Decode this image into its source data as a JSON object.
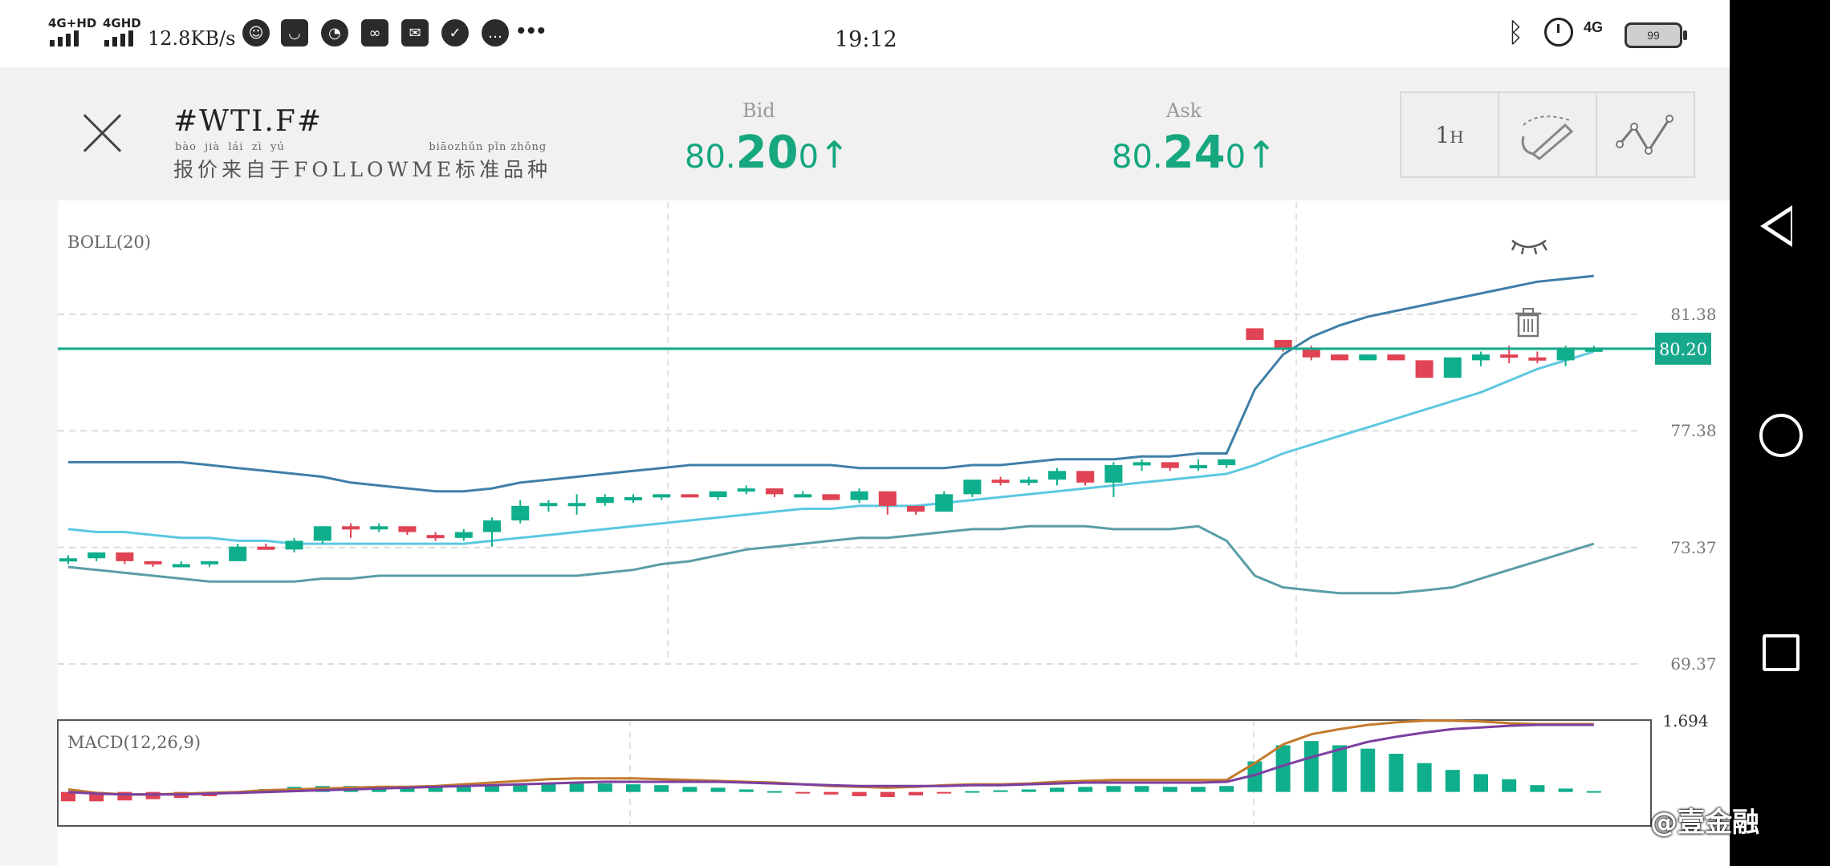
{
  "status_bar": {
    "sim1": "4G+HD",
    "sim2": "4GHD",
    "net_speed": "12.8KB/s",
    "time": "19:12",
    "net_right": "4G",
    "battery": "99"
  },
  "header": {
    "symbol": "#WTI.F#",
    "source_pinyin": "bào  jià  lái  zì  yú                                   biāozhǔn pǐn zhǒng",
    "source": "报价来自于FOLLOWME标准品种",
    "bid": {
      "label": "Bid",
      "prefix": "80.",
      "big": "20",
      "suffix": "0",
      "arrow": "↑"
    },
    "ask": {
      "label": "Ask",
      "prefix": "80.",
      "big": "24",
      "suffix": "0",
      "arrow": "↑"
    },
    "timeframe": {
      "num": "1",
      "unit": "H"
    }
  },
  "icons": [
    "close-icon",
    "draw-tool-icon",
    "indicator-line-icon",
    "eye-closed-icon",
    "trash-icon",
    "back-icon",
    "home-icon",
    "recent-apps-icon"
  ],
  "colors": {
    "bull": "#0fae8c",
    "bear": "#e04353",
    "boll_upper": "#3f7fa8",
    "boll_mid": "#5cc8e0",
    "boll_lower": "#5a9ea6",
    "price_line": "#17a88c",
    "macd_fast": "#c47a2c",
    "macd_slow": "#7b3fa0"
  },
  "watermark": "@壹金融",
  "chart_data": {
    "type": "candlestick",
    "main": {
      "indicator_label": "BOLL(20)",
      "y_ticks": [
        "81.38",
        "77.38",
        "73.37",
        "69.37"
      ],
      "ylim": [
        69.37,
        81.38
      ],
      "current_price": "80.20",
      "candles": [
        [
          72.9,
          73.1,
          72.8,
          73.0
        ],
        [
          73.0,
          73.2,
          72.9,
          73.2
        ],
        [
          73.2,
          73.2,
          72.8,
          72.9
        ],
        [
          72.9,
          72.9,
          72.7,
          72.8
        ],
        [
          72.8,
          72.9,
          72.7,
          72.8
        ],
        [
          72.8,
          72.9,
          72.7,
          72.9
        ],
        [
          72.9,
          73.5,
          72.9,
          73.4
        ],
        [
          73.4,
          73.5,
          73.3,
          73.3
        ],
        [
          73.3,
          73.7,
          73.2,
          73.6
        ],
        [
          73.6,
          74.1,
          73.5,
          74.1
        ],
        [
          74.1,
          74.2,
          73.7,
          74.0
        ],
        [
          74.0,
          74.2,
          73.9,
          74.1
        ],
        [
          74.1,
          74.1,
          73.8,
          73.9
        ],
        [
          73.8,
          73.9,
          73.6,
          73.7
        ],
        [
          73.7,
          74.0,
          73.6,
          73.9
        ],
        [
          73.9,
          74.4,
          73.4,
          74.3
        ],
        [
          74.3,
          75.0,
          74.2,
          74.8
        ],
        [
          74.8,
          75.0,
          74.6,
          74.9
        ],
        [
          74.9,
          75.2,
          74.5,
          74.9
        ],
        [
          74.9,
          75.2,
          74.8,
          75.1
        ],
        [
          75.1,
          75.2,
          74.9,
          75.1
        ],
        [
          75.1,
          75.2,
          75.0,
          75.2
        ],
        [
          75.2,
          75.2,
          75.1,
          75.1
        ],
        [
          75.1,
          75.3,
          75.0,
          75.3
        ],
        [
          75.3,
          75.5,
          75.2,
          75.4
        ],
        [
          75.4,
          75.4,
          75.1,
          75.2
        ],
        [
          75.2,
          75.3,
          75.1,
          75.2
        ],
        [
          75.2,
          75.2,
          75.0,
          75.0
        ],
        [
          75.0,
          75.4,
          74.9,
          75.3
        ],
        [
          75.3,
          75.3,
          74.5,
          74.8
        ],
        [
          74.8,
          74.8,
          74.5,
          74.6
        ],
        [
          74.6,
          75.3,
          74.6,
          75.2
        ],
        [
          75.2,
          75.7,
          75.1,
          75.7
        ],
        [
          75.7,
          75.8,
          75.5,
          75.6
        ],
        [
          75.6,
          75.8,
          75.5,
          75.7
        ],
        [
          75.7,
          76.1,
          75.5,
          76.0
        ],
        [
          76.0,
          76.0,
          75.5,
          75.6
        ],
        [
          75.6,
          76.3,
          75.1,
          76.2
        ],
        [
          76.2,
          76.4,
          76.0,
          76.3
        ],
        [
          76.3,
          76.3,
          76.0,
          76.1
        ],
        [
          76.1,
          76.4,
          76.0,
          76.2
        ],
        [
          76.2,
          76.4,
          76.1,
          76.4
        ],
        [
          80.9,
          80.9,
          80.5,
          80.5
        ],
        [
          80.5,
          80.5,
          80.1,
          80.2
        ],
        [
          80.2,
          80.3,
          79.8,
          79.9
        ],
        [
          80.0,
          80.0,
          79.8,
          79.8
        ],
        [
          79.8,
          80.0,
          79.8,
          80.0
        ],
        [
          80.0,
          80.0,
          79.8,
          79.8
        ],
        [
          79.8,
          79.8,
          79.2,
          79.2
        ],
        [
          79.2,
          79.9,
          79.2,
          79.9
        ],
        [
          79.8,
          80.1,
          79.6,
          80.0
        ],
        [
          80.0,
          80.3,
          79.7,
          79.9
        ],
        [
          79.9,
          80.1,
          79.7,
          79.8
        ],
        [
          79.8,
          80.3,
          79.6,
          80.2
        ],
        [
          80.2,
          80.3,
          80.1,
          80.2
        ]
      ],
      "boll_upper": [
        76.3,
        76.3,
        76.3,
        76.3,
        76.3,
        76.2,
        76.1,
        76.0,
        75.9,
        75.8,
        75.6,
        75.5,
        75.4,
        75.3,
        75.3,
        75.4,
        75.6,
        75.7,
        75.8,
        75.9,
        76.0,
        76.1,
        76.2,
        76.2,
        76.2,
        76.2,
        76.2,
        76.2,
        76.1,
        76.1,
        76.1,
        76.1,
        76.2,
        76.2,
        76.3,
        76.4,
        76.4,
        76.4,
        76.5,
        76.5,
        76.6,
        76.6,
        78.8,
        80.0,
        80.6,
        81.0,
        81.3,
        81.5,
        81.7,
        81.9,
        82.1,
        82.3,
        82.5,
        82.6,
        82.7
      ],
      "boll_mid": [
        74.0,
        73.9,
        73.9,
        73.8,
        73.7,
        73.7,
        73.6,
        73.6,
        73.5,
        73.5,
        73.5,
        73.5,
        73.5,
        73.5,
        73.5,
        73.6,
        73.7,
        73.8,
        73.9,
        74.0,
        74.1,
        74.2,
        74.3,
        74.4,
        74.5,
        74.6,
        74.7,
        74.7,
        74.8,
        74.8,
        74.8,
        74.9,
        75.0,
        75.1,
        75.2,
        75.3,
        75.4,
        75.5,
        75.6,
        75.7,
        75.8,
        75.9,
        76.2,
        76.6,
        76.9,
        77.2,
        77.5,
        77.8,
        78.1,
        78.4,
        78.7,
        79.1,
        79.5,
        79.8,
        80.1
      ],
      "boll_lower": [
        72.7,
        72.6,
        72.5,
        72.4,
        72.3,
        72.2,
        72.2,
        72.2,
        72.2,
        72.3,
        72.3,
        72.4,
        72.4,
        72.4,
        72.4,
        72.4,
        72.4,
        72.4,
        72.4,
        72.5,
        72.6,
        72.8,
        72.9,
        73.1,
        73.3,
        73.4,
        73.5,
        73.6,
        73.7,
        73.7,
        73.8,
        73.9,
        74.0,
        74.0,
        74.1,
        74.1,
        74.1,
        74.0,
        74.0,
        74.0,
        74.1,
        73.6,
        72.4,
        72.0,
        71.9,
        71.8,
        71.8,
        71.8,
        71.9,
        72.0,
        72.3,
        72.6,
        72.9,
        73.2,
        73.5
      ]
    },
    "macd": {
      "indicator_label": "MACD(12,26,9)",
      "y_top_label": "1.694",
      "ylim": [
        -0.8,
        1.694
      ],
      "hist": [
        -0.22,
        -0.22,
        -0.2,
        -0.17,
        -0.14,
        -0.1,
        -0.05,
        0.07,
        0.12,
        0.14,
        0.14,
        0.12,
        0.1,
        0.12,
        0.14,
        0.17,
        0.2,
        0.22,
        0.22,
        0.2,
        0.18,
        0.16,
        0.12,
        0.1,
        0.06,
        0.02,
        -0.02,
        -0.06,
        -0.1,
        -0.12,
        -0.08,
        -0.02,
        0.02,
        0.04,
        0.06,
        0.1,
        0.12,
        0.14,
        0.14,
        0.12,
        0.12,
        0.14,
        0.72,
        1.1,
        1.2,
        1.1,
        1.02,
        0.9,
        0.68,
        0.52,
        0.42,
        0.3,
        0.16,
        0.08,
        0.02
      ],
      "fast": [
        0.06,
        -0.02,
        -0.06,
        -0.06,
        -0.04,
        -0.02,
        0.0,
        0.04,
        0.06,
        0.08,
        0.1,
        0.12,
        0.12,
        0.14,
        0.18,
        0.22,
        0.26,
        0.3,
        0.32,
        0.32,
        0.32,
        0.3,
        0.28,
        0.26,
        0.24,
        0.22,
        0.18,
        0.14,
        0.12,
        0.1,
        0.12,
        0.16,
        0.18,
        0.18,
        0.2,
        0.24,
        0.26,
        0.28,
        0.28,
        0.28,
        0.28,
        0.28,
        0.68,
        1.12,
        1.36,
        1.48,
        1.58,
        1.64,
        1.68,
        1.68,
        1.66,
        1.62,
        1.6,
        1.6,
        1.6
      ],
      "slow": [
        0.0,
        -0.04,
        -0.06,
        -0.06,
        -0.06,
        -0.04,
        -0.02,
        0.0,
        0.02,
        0.04,
        0.06,
        0.08,
        0.1,
        0.12,
        0.14,
        0.16,
        0.18,
        0.2,
        0.22,
        0.24,
        0.24,
        0.24,
        0.24,
        0.24,
        0.22,
        0.2,
        0.18,
        0.16,
        0.14,
        0.14,
        0.14,
        0.14,
        0.16,
        0.16,
        0.18,
        0.2,
        0.22,
        0.22,
        0.22,
        0.22,
        0.22,
        0.24,
        0.4,
        0.62,
        0.82,
        1.0,
        1.18,
        1.3,
        1.4,
        1.48,
        1.52,
        1.56,
        1.58,
        1.58,
        1.58
      ]
    }
  }
}
